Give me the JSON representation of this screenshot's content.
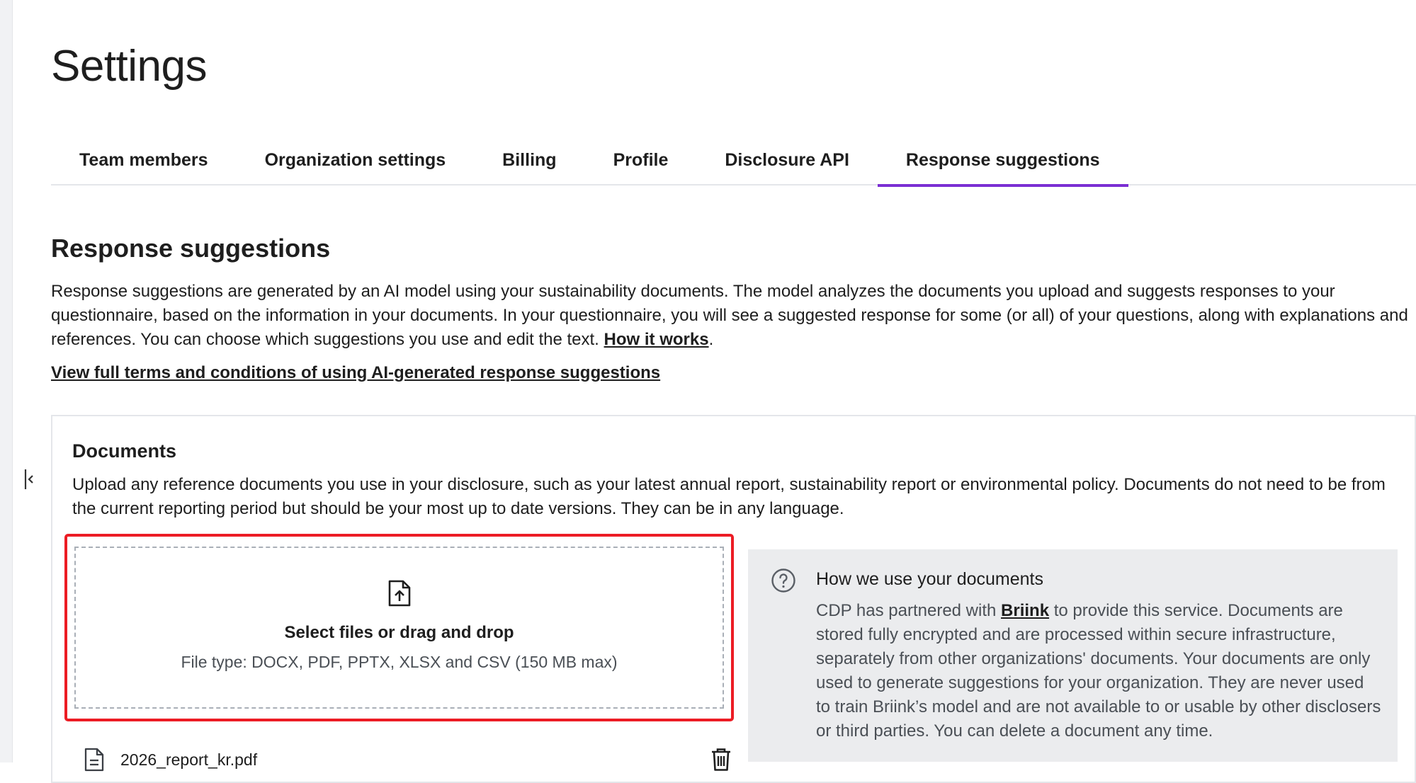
{
  "page": {
    "title": "Settings"
  },
  "tabs": [
    {
      "label": "Team members",
      "active": false
    },
    {
      "label": "Organization settings",
      "active": false
    },
    {
      "label": "Billing",
      "active": false
    },
    {
      "label": "Profile",
      "active": false
    },
    {
      "label": "Disclosure API",
      "active": false
    },
    {
      "label": "Response suggestions",
      "active": true
    }
  ],
  "section": {
    "title": "Response suggestions",
    "intro_text": "Response suggestions are generated by an AI model using your sustainability documents. The model analyzes the documents you upload and suggests responses to your questionnaire, based on the information in your documents. In your questionnaire, you will see a suggested response for some (or all) of your questions, along with explanations and references. You can choose which suggestions you use and edit the text.",
    "how_it_works_link": "How it works",
    "intro_trailing": ".",
    "terms_link": "View full terms and conditions of using AI-generated response suggestions"
  },
  "documents": {
    "title": "Documents",
    "description": "Upload any reference documents you use in your disclosure, such as your latest annual report, sustainability report or environmental policy. Documents do not need to be from the current reporting period but should be your most up to date versions. They can be in any language.",
    "dropzone_label": "Select files or drag and drop",
    "dropzone_hint": "File type: DOCX, PDF, PPTX, XLSX and CSV (150 MB max)",
    "files": [
      {
        "name": "2026_report_kr.pdf"
      }
    ]
  },
  "info": {
    "title": "How we use your documents",
    "body_prefix": "CDP has partnered with",
    "partner_link": "Briink",
    "body_suffix": "to provide this service. Documents are stored fully encrypted and are processed within secure infrastructure, separately from other organizations' documents. Your documents are only used to generate suggestions for your organization. They are never used to train Briink’s model and are not available to or usable by other disclosers or third parties. You can delete a document any time."
  },
  "colors": {
    "accent": "#7b2fd3",
    "highlight": "#ec1c24",
    "info_bg": "#ebecee"
  },
  "icons": {
    "collapse": "collapse-sidebar-icon",
    "upload": "file-upload-icon",
    "help": "question-circle-icon",
    "file": "document-icon",
    "delete": "trash-icon"
  }
}
